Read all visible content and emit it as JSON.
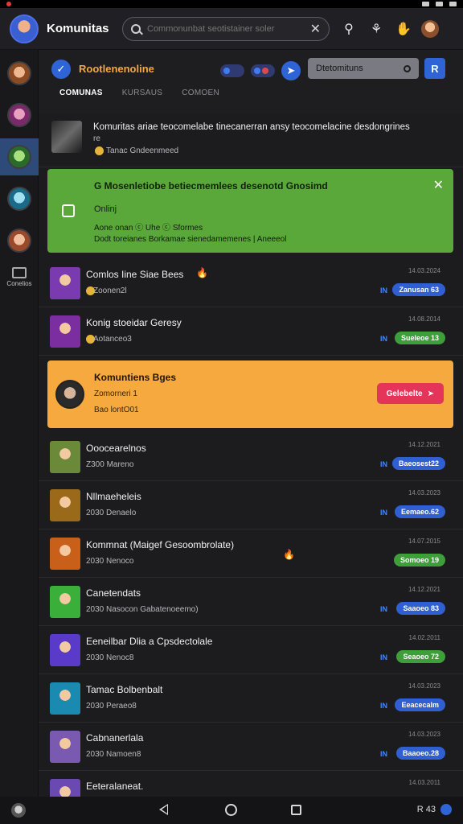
{
  "header": {
    "title": "Komunitas",
    "search_placeholder": "Commonunbat seotistainer soler",
    "clear_icon": "close-icon"
  },
  "rail": {
    "items": [
      {
        "name": "rail-avatar-1",
        "color": "#c87a3c"
      },
      {
        "name": "rail-avatar-2",
        "color": "#b24a8a"
      },
      {
        "name": "rail-avatar-3",
        "color": "#3a8a3a"
      },
      {
        "name": "rail-avatar-4",
        "color": "#3aa0c8"
      },
      {
        "name": "rail-avatar-5",
        "color": "#c86a3a"
      }
    ],
    "label": "Conelios"
  },
  "channel": {
    "name": "Rootlenenoline",
    "search_label": "Dtetomituns"
  },
  "tabs": [
    "COMUNAS",
    "KURSAUS",
    "COMOEN"
  ],
  "top_item": {
    "title": "Komuritas ariae teocomelabe tinecanerran ansy teocomelacine desdongrines",
    "title2": "re",
    "sub": "Tanac Gndeenmeed"
  },
  "green_banner": {
    "title": "G Mosenletiobe betiecmemlees desenotd Gnosimd",
    "online": "Onlinj",
    "line1": "Aone onan ⓒ Uhe ⓒ Sformes",
    "line2": "Dodt toreianes Borkamae sienedamemenes | Aneeeol"
  },
  "orange_banner": {
    "title": "Komuntiens Bges",
    "sub": "Zomorneri 1",
    "sub2": "Bao lontO01",
    "button": "Gelebelte"
  },
  "rows": [
    {
      "title": "Comlos Iine Siae Bees",
      "sub": "Zoonen2l",
      "time": "14.03.2024",
      "badge": "Zanusan 63",
      "badge_color": "blue",
      "flag": "IN",
      "fire": true,
      "fire_pos": "title",
      "subicon": true,
      "thumb": "#7a3ab0"
    },
    {
      "title": "Konig stoeidar Geresy",
      "sub": "Aotanceo3",
      "time": "14.08.2014",
      "badge": "Sueleoe 13",
      "badge_color": "green",
      "flag": "IN",
      "fire": false,
      "subicon": true,
      "thumb": "#7a2ea0"
    },
    {
      "title": "Ooocearelnos",
      "sub": "Z300 Mareno",
      "time": "14.12.2021",
      "badge": "Baeosest22",
      "badge_color": "blue",
      "flag": "IN",
      "fire": false,
      "subicon": false,
      "thumb": "#6a8a3a"
    },
    {
      "title": "Nllmaeheleis",
      "sub": "2030 Denaelo",
      "time": "14.03.2023",
      "badge": "Eemaeo.62",
      "badge_color": "blue",
      "flag": "IN",
      "fire": false,
      "subicon": false,
      "thumb": "#9a6a1a"
    },
    {
      "title": "Kommnat (Maigef Gesoombrolate)",
      "sub": "2030 Nenoco",
      "time": "14.07.2015",
      "badge": "Somoeo 19",
      "badge_color": "green",
      "flag": "",
      "fire": true,
      "fire_pos": "mid",
      "subicon": false,
      "thumb": "#c8601a"
    },
    {
      "title": "Canetendats",
      "sub": "2030 Nasocon Gabatenoeemo)",
      "time": "14.12.2021",
      "badge": "Saaoeo 83",
      "badge_color": "blue",
      "flag": "IN",
      "fire": false,
      "subicon": false,
      "thumb": "#3ab03a"
    },
    {
      "title": "Eeneilbar Dlia a Cpsdectolale",
      "sub": "2030 Nenoc8",
      "time": "14.02.2011",
      "badge": "Seaoeo 72",
      "badge_color": "green",
      "flag": "IN",
      "fire": false,
      "subicon": false,
      "thumb": "#5a3ac8"
    },
    {
      "title": "Tamac Bolbenbalt",
      "sub": "2030 Peraeo8",
      "time": "14.03.2023",
      "badge": "Eeacecalm",
      "badge_color": "blue",
      "flag": "IN",
      "fire": false,
      "subicon": false,
      "thumb": "#1a8ab0"
    },
    {
      "title": "Cabnanerlala",
      "sub": "2030 Namoen8",
      "time": "14.03.2023",
      "badge": "Baaoeo.28",
      "badge_color": "blue",
      "flag": "IN",
      "fire": false,
      "subicon": false,
      "thumb": "#7a5ab0"
    },
    {
      "title": "Eeteralaneat.",
      "sub": "",
      "time": "14.03.2011",
      "badge": "",
      "badge_color": "blue",
      "flag": "",
      "fire": false,
      "subicon": false,
      "thumb": "#6a4ab0"
    }
  ],
  "navbar": {
    "right_label": "R 43"
  }
}
